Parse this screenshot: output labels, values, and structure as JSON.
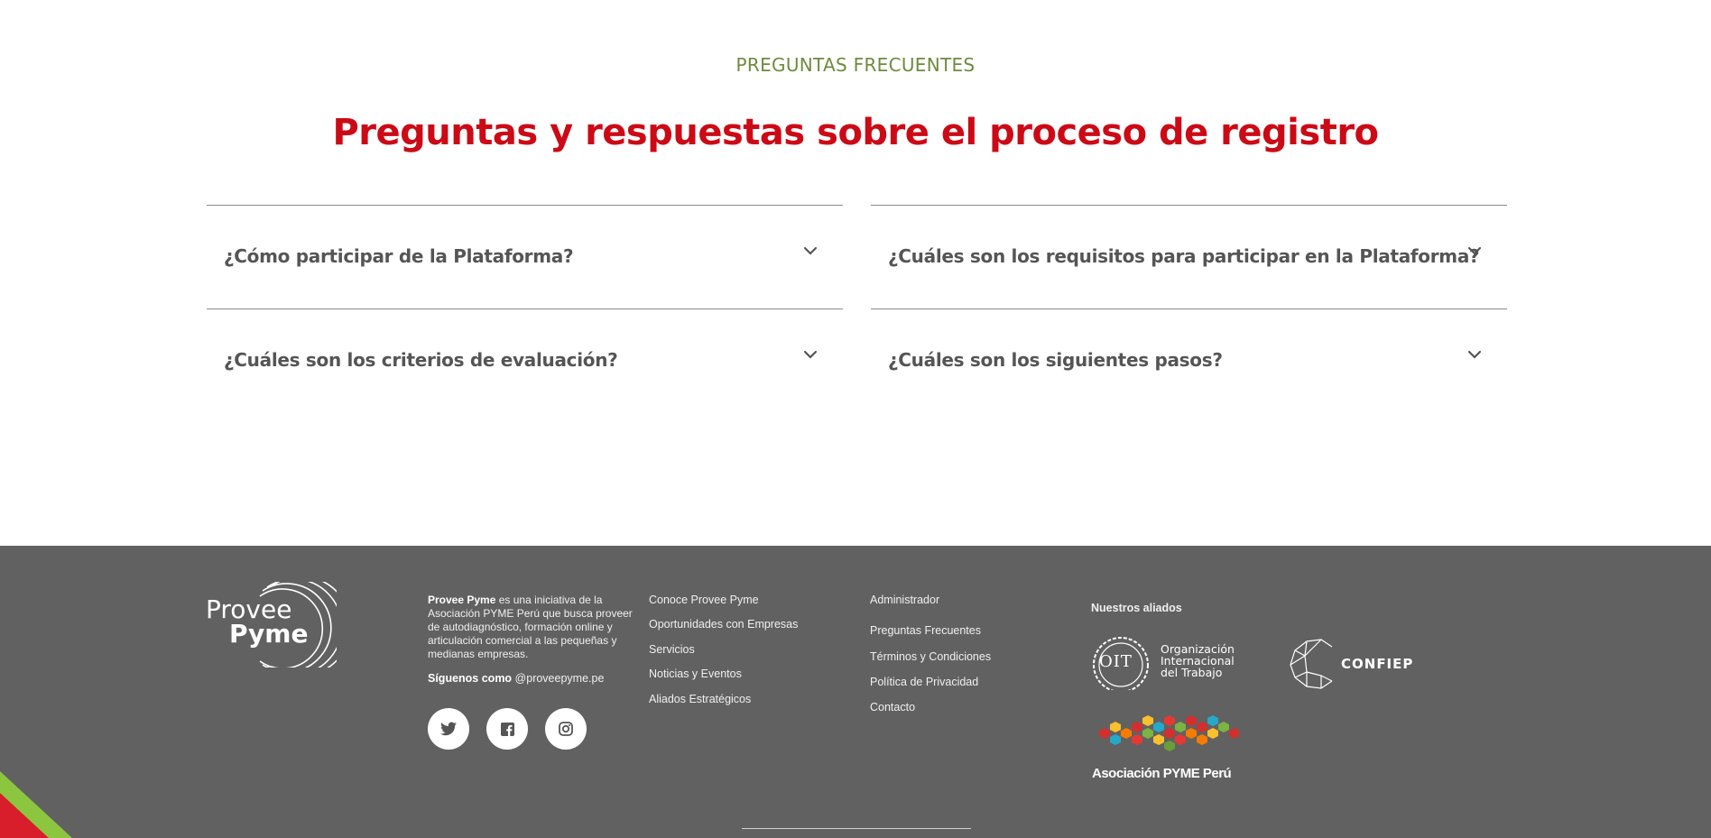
{
  "faq": {
    "eyebrow": "PREGUNTAS FRECUENTES",
    "title": "Preguntas y respuestas sobre el proceso de registro",
    "items": [
      {
        "question": "¿Cómo participar de la Plataforma?"
      },
      {
        "question": "¿Cuáles son los requisitos para participar en la Plataforma?"
      },
      {
        "question": "¿Cuáles son los criterios de evaluación?"
      },
      {
        "question": "¿Cuáles son los siguientes pasos?"
      }
    ]
  },
  "footer": {
    "logo": {
      "line1": "Provee",
      "line2": "Pyme"
    },
    "about": {
      "brand": "Provee Pyme",
      "text": " es una iniciativa de la Asociación PYME Perú que busca proveer de autodiagnóstico, formación online y articulación comercial a las pequeñas y medianas empresas."
    },
    "follow": {
      "label": "Síguenos como",
      "handle": " @proveepyme.pe"
    },
    "social": [
      "twitter-icon",
      "facebook-icon",
      "instagram-icon"
    ],
    "links_col1": [
      "Conoce Provee Pyme",
      "Oportunidades con Empresas",
      "Servicios",
      "Noticias y Eventos",
      "Aliados Estratégicos"
    ],
    "links_col2": [
      "Administrador",
      "Preguntas Frecuentes",
      "Términos y Condiciones",
      "Política de Privacidad",
      "Contacto"
    ],
    "allies": {
      "title": "Nuestros aliados",
      "oit": {
        "mark": "OIT",
        "line1": "Organización",
        "line2": "Internacional",
        "line3": "del Trabajo"
      },
      "confiep": "CONFIEP",
      "apyme": "Asociación PYME Perú"
    }
  },
  "colors": {
    "accent_red": "#cc0a16",
    "accent_green": "#6e8b3d",
    "footer_bg": "#616161"
  }
}
